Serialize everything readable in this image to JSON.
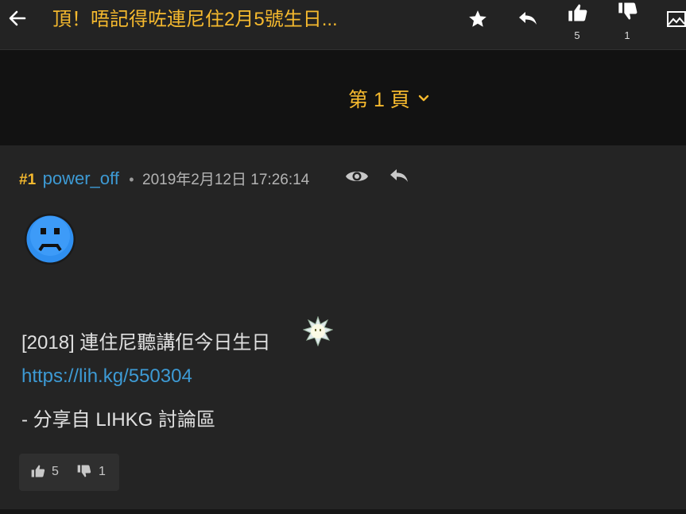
{
  "header": {
    "title": "頂！唔記得咗連尼住2月5號生日...",
    "like_count": "5",
    "dislike_count": "1"
  },
  "pager": {
    "label": "第 1 頁"
  },
  "post": {
    "floor": "#1",
    "username": "power_off",
    "separator": "•",
    "timestamp": "2019年2月12日 17:26:14",
    "line1": "[2018] 連住尼聽講佢今日生日",
    "link": "https://lih.kg/550304",
    "share_line": "- 分享自 LIHKG 討論區",
    "votes": {
      "up": "5",
      "down": "1"
    }
  },
  "colors": {
    "accent": "#f5b92e",
    "link": "#3d9ad4",
    "background": "#1b1b1b",
    "post_background": "#242424"
  },
  "icons": {
    "back": "arrow-left-icon",
    "star": "star-icon",
    "reply": "reply-icon",
    "like": "thumbs-up-icon",
    "dislike": "thumbs-down-icon",
    "image": "image-icon",
    "eye": "eye-icon",
    "chevron": "chevron-down-icon"
  }
}
